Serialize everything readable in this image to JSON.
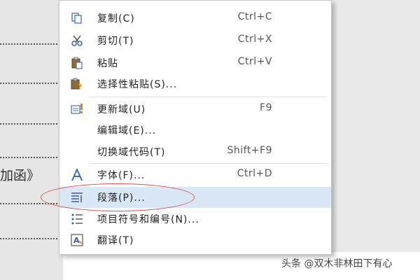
{
  "document": {
    "text_fragment": "加函》",
    "top_right_fragment": "F9"
  },
  "context_menu": {
    "items": [
      {
        "label": "复制(C)",
        "shortcut": "Ctrl+C",
        "icon": "copy-icon"
      },
      {
        "label": "剪切(T)",
        "shortcut": "Ctrl+X",
        "icon": "scissors-icon"
      },
      {
        "label": "粘贴",
        "shortcut": "Ctrl+V",
        "icon": "paste-icon"
      },
      {
        "label": "选择性粘贴(S)...",
        "shortcut": "",
        "icon": "paste-special-icon"
      },
      {
        "label": "更新域(U)",
        "shortcut": "F9",
        "icon": "update-field-icon"
      },
      {
        "label": "编辑域(E)...",
        "shortcut": "",
        "icon": ""
      },
      {
        "label": "切换域代码(T)",
        "shortcut": "Shift+F9",
        "icon": ""
      },
      {
        "label": "字体(F)...",
        "shortcut": "Ctrl+D",
        "icon": "font-icon"
      },
      {
        "label": "段落(P)...",
        "shortcut": "",
        "icon": "paragraph-icon"
      },
      {
        "label": "项目符号和编号(N)...",
        "shortcut": "",
        "icon": "bullets-icon"
      },
      {
        "label": "翻译(T)",
        "shortcut": "",
        "icon": "translate-icon"
      }
    ],
    "highlighted_item": "段落(P)..."
  },
  "watermark": "头条 @双木非林田下有心",
  "colors": {
    "hover": "#d9e7f6",
    "annotation_circle": "#d1544f"
  }
}
